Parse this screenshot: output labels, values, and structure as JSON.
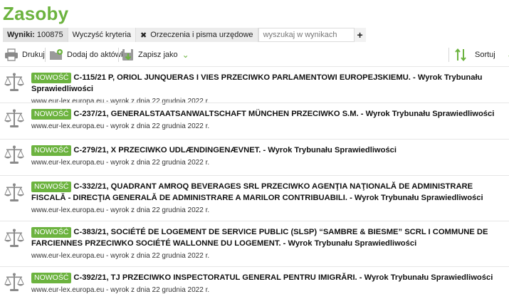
{
  "page": {
    "title": "Zasoby"
  },
  "filters": {
    "results_label": "Wyniki:",
    "results_count": "100875",
    "clear_label": "Wyczyść kryteria",
    "chip_label": "Orzeczenia i pisma urzędowe",
    "search_placeholder": "wyszukaj w wynikach"
  },
  "toolbar": {
    "print_label": "Drukuj",
    "add_label": "Dodaj do aktówki",
    "save_label": "Zapisz jako",
    "sort_label": "Sortuj"
  },
  "colors": {
    "accent": "#6cb33f",
    "icon_gray": "#8a8a8a"
  },
  "items": [
    {
      "badge": "NOWOŚĆ",
      "title": "C-115/21 P, ORIOL JUNQUERAS I VIES PRZECIWKO PARLAMENTOWI EUROPEJSKIEMU. - Wyrok Trybunału Sprawiedliwości",
      "meta": "www.eur-lex.europa.eu - wyrok z dnia 22 grudnia 2022 r."
    },
    {
      "badge": "NOWOŚĆ",
      "title": "C-237/21, GENERALSTAATSANWALTSCHAFT MÜNCHEN PRZECIWKO S.M. - Wyrok Trybunału Sprawiedliwości",
      "meta": "www.eur-lex.europa.eu - wyrok z dnia 22 grudnia 2022 r."
    },
    {
      "badge": "NOWOŚĆ",
      "title": "C-279/21, X PRZECIWKO UDLÆNDINGENÆVNET. - Wyrok Trybunału Sprawiedliwości",
      "meta": "www.eur-lex.europa.eu - wyrok z dnia 22 grudnia 2022 r."
    },
    {
      "badge": "NOWOŚĆ",
      "title": "C-332/21, QUADRANT AMROQ BEVERAGES SRL PRZECIWKO AGENŢIA NAŢIONALĂ DE ADMINISTRARE FISCALĂ - DIRECŢIA GENERALĂ DE ADMINISTRARE A MARILOR CONTRIBUABILI. - Wyrok Trybunału Sprawiedliwości",
      "meta": "www.eur-lex.europa.eu - wyrok z dnia 22 grudnia 2022 r."
    },
    {
      "badge": "NOWOŚĆ",
      "title": "C-383/21, SOCIÉTÉ DE LOGEMENT DE SERVICE PUBLIC (SLSP) “SAMBRE & BIESME” SCRL I COMMUNE DE FARCIENNES PRZECIWKO SOCIÉTÉ WALLONNE DU LOGEMENT. - Wyrok Trybunału Sprawiedliwości",
      "meta": "www.eur-lex.europa.eu - wyrok z dnia 22 grudnia 2022 r."
    },
    {
      "badge": "NOWOŚĆ",
      "title": "C-392/21, TJ PRZECIWKO INSPECTORATUL GENERAL PENTRU IMIGRĂRI. - Wyrok Trybunału Sprawiedliwości",
      "meta": "www.eur-lex.europa.eu - wyrok z dnia 22 grudnia 2022 r."
    }
  ]
}
